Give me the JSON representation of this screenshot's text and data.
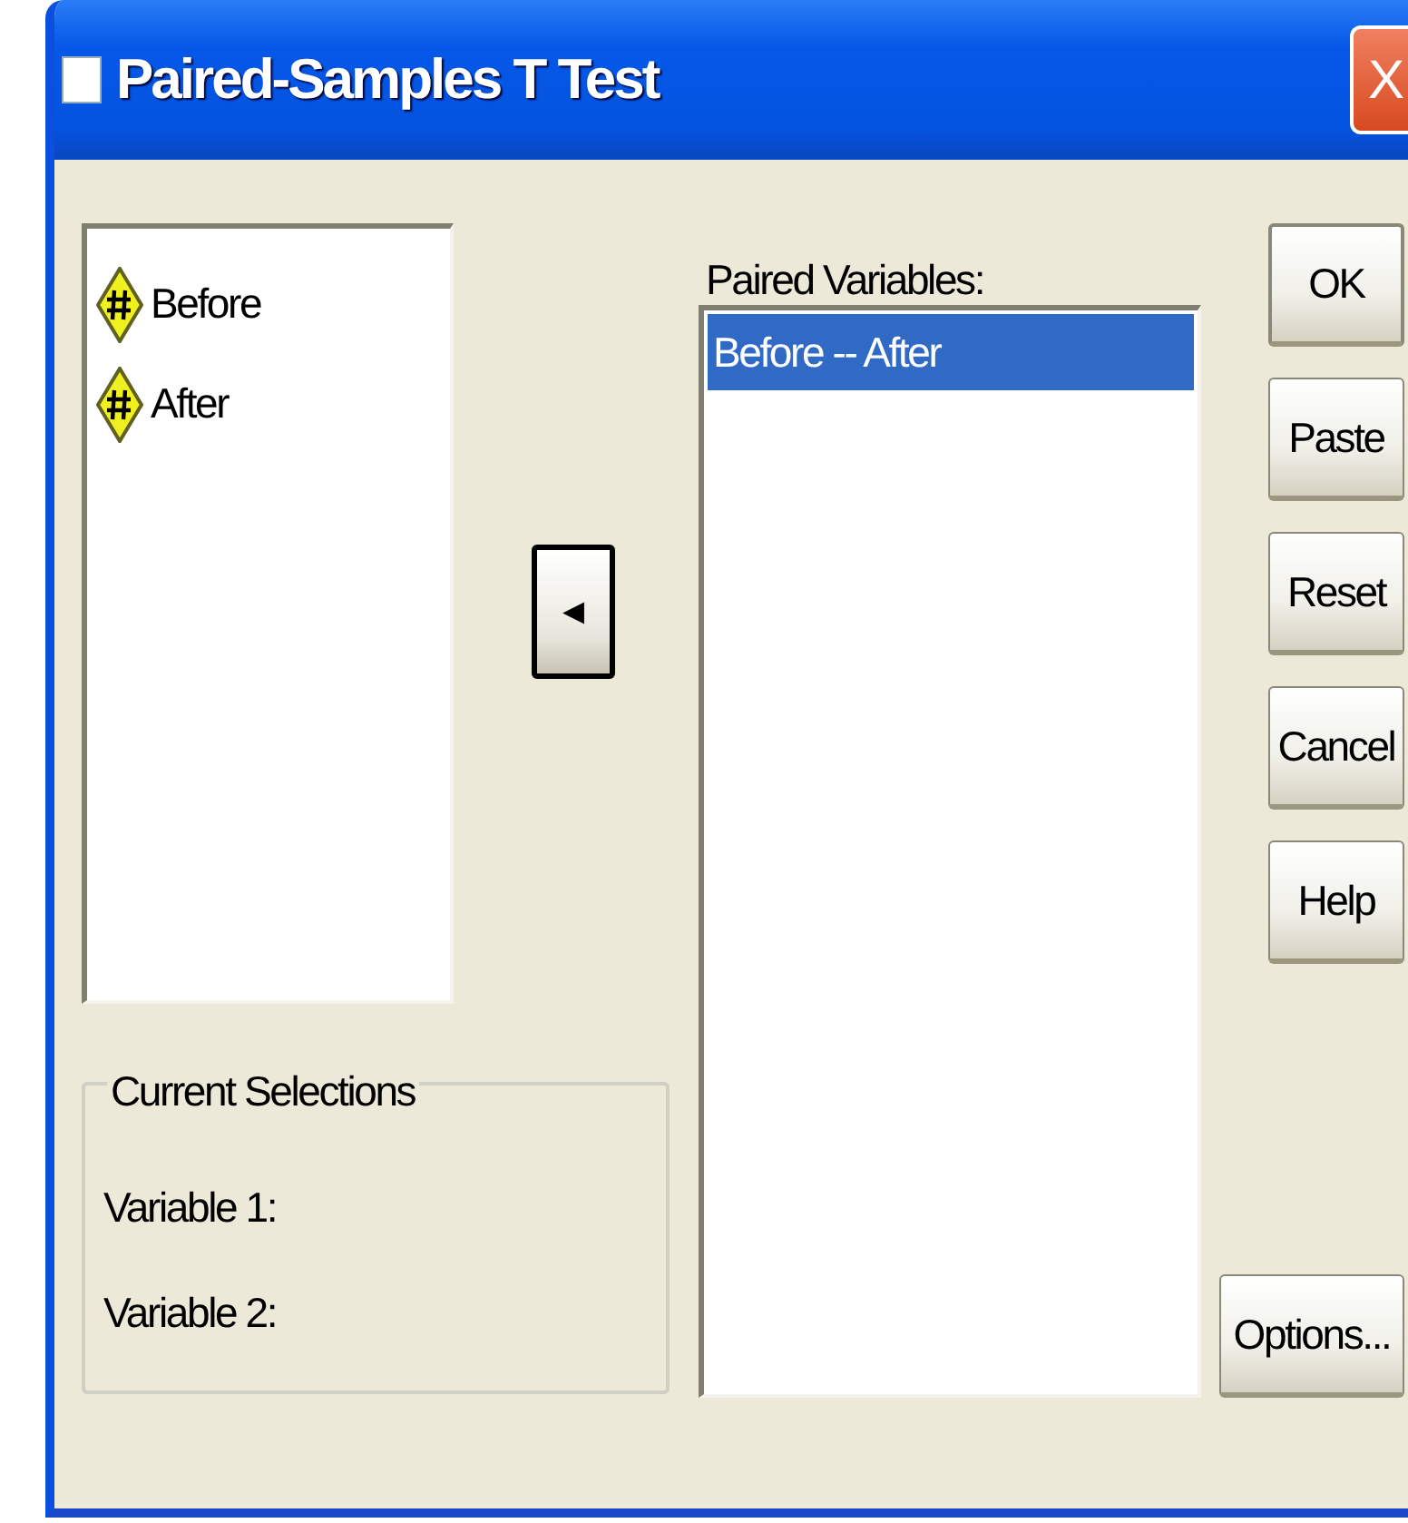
{
  "window": {
    "title": "Paired-Samples T Test",
    "close_label": "X"
  },
  "variables": [
    {
      "name": "Before",
      "selected": false
    },
    {
      "name": "After",
      "selected": false
    }
  ],
  "move_button": {
    "label": "◂"
  },
  "paired_variables": {
    "label": "Paired Variables:",
    "items": [
      {
        "text": "Before -- After",
        "selected": true
      }
    ]
  },
  "current_selections": {
    "title": "Current Selections",
    "fields": [
      "Variable 1:",
      "Variable 2:"
    ]
  },
  "buttons": [
    {
      "label": "OK",
      "default": true
    },
    {
      "label": "Paste",
      "default": false
    },
    {
      "label": "Reset",
      "default": false
    },
    {
      "label": "Cancel",
      "default": false
    },
    {
      "label": "Help",
      "default": false
    }
  ],
  "options_button": {
    "label": "Options..."
  }
}
